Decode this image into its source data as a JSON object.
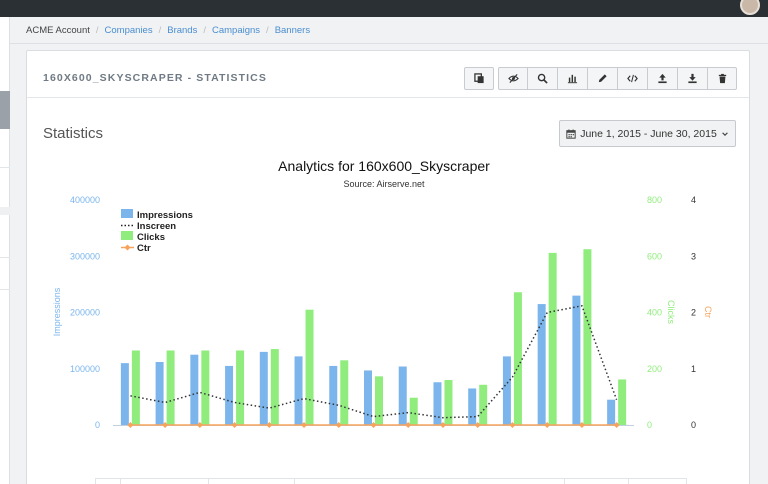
{
  "breadcrumb": [
    "ACME Account",
    "Companies",
    "Brands",
    "Campaigns",
    "Banners"
  ],
  "panel": {
    "title": "160X600_SKYSCRAPER - STATISTICS"
  },
  "toolbar": {
    "buttons": [
      {
        "name": "copy-button",
        "icon": "copy-icon"
      },
      {
        "name": "hide-button",
        "icon": "eye-slash-icon"
      },
      {
        "name": "search-button",
        "icon": "search-icon"
      },
      {
        "name": "statistics-button",
        "icon": "bar-chart-icon"
      },
      {
        "name": "edit-button",
        "icon": "pencil-icon"
      },
      {
        "name": "code-button",
        "icon": "code-icon"
      },
      {
        "name": "upload-button",
        "icon": "upload-icon"
      },
      {
        "name": "download-button",
        "icon": "download-icon"
      },
      {
        "name": "delete-button",
        "icon": "trash-icon"
      }
    ]
  },
  "stats": {
    "title": "Statistics",
    "date_range": "June 1, 2015 - June 30, 2015",
    "date_icon": "calendar-icon",
    "dropdown_icon": "chevron-down-icon"
  },
  "colors": {
    "impressions": "#7cb5ec",
    "clicks": "#90ed7d",
    "ctr": "#f7a35c",
    "inscreen": "#333333",
    "link": "#4a8ed0"
  },
  "chart_data": {
    "type": "bar",
    "title": "Analytics for 160x600_Skyscraper",
    "subtitle": "Source: Airserve.net",
    "legend_position": "top-left",
    "grid": false,
    "axes": {
      "impressions": {
        "label": "Impressions",
        "ticks": [
          "0",
          "100000",
          "200000",
          "300000",
          "400000"
        ],
        "range": [
          0,
          400000
        ],
        "side": "left"
      },
      "clicks": {
        "label": "Clicks",
        "ticks": [
          "0",
          "200",
          "400",
          "600",
          "800"
        ],
        "range": [
          0,
          800
        ],
        "side": "right"
      },
      "ctr": {
        "label": "Ctr",
        "ticks": [
          "0",
          "1",
          "2",
          "3",
          "4"
        ],
        "range": [
          0,
          4
        ],
        "side": "right"
      }
    },
    "series": [
      {
        "name": "Impressions",
        "kind": "column",
        "axis": "impressions",
        "values": [
          110000,
          112000,
          125000,
          105000,
          130000,
          122000,
          105000,
          97000,
          104000,
          76000,
          65000,
          122000,
          215000,
          230000,
          45000
        ]
      },
      {
        "name": "Inscreen",
        "kind": "dotted-line",
        "axis": "impressions",
        "values": [
          52000,
          40000,
          58000,
          40000,
          30000,
          47000,
          35000,
          15000,
          22000,
          13000,
          15000,
          85000,
          200000,
          212000,
          45000
        ]
      },
      {
        "name": "Clicks",
        "kind": "column",
        "axis": "clicks",
        "values": [
          265,
          265,
          265,
          265,
          270,
          410,
          230,
          173,
          97,
          160,
          143,
          472,
          612,
          625,
          162
        ]
      },
      {
        "name": "Ctr",
        "kind": "line",
        "axis": "ctr",
        "values": [
          0,
          0,
          0,
          0,
          0,
          0,
          0,
          0,
          0,
          0,
          0,
          0,
          0,
          0,
          0
        ]
      }
    ]
  }
}
